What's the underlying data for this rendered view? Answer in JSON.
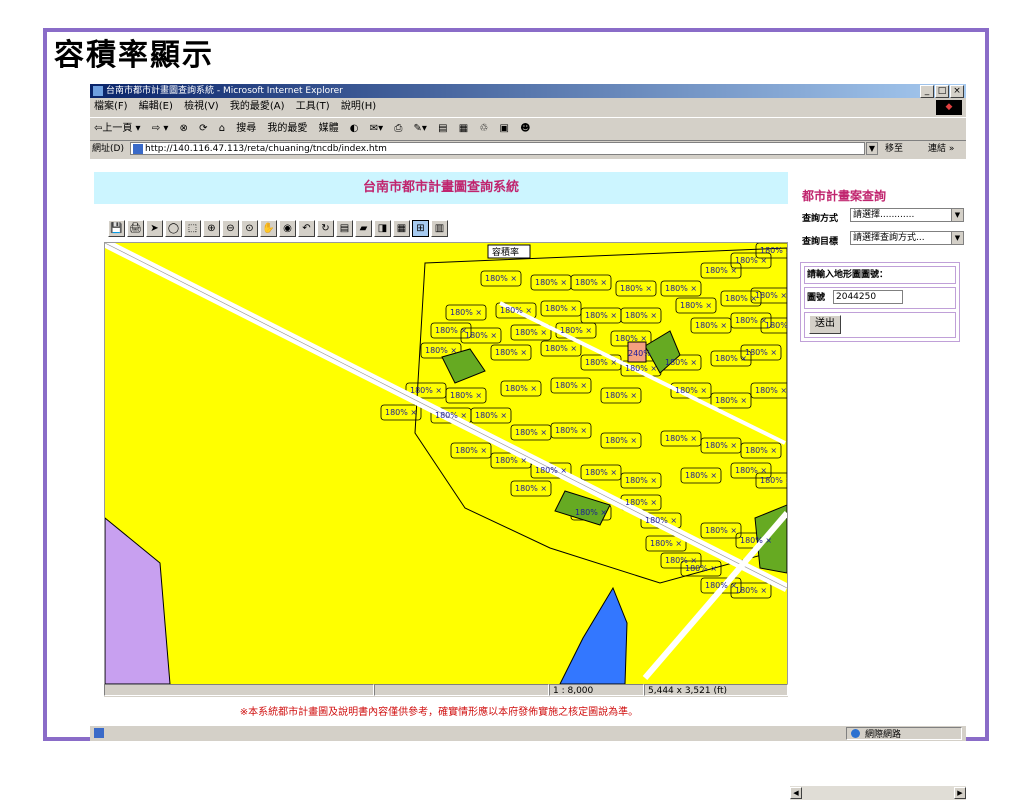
{
  "slide": {
    "title": "容積率顯示"
  },
  "browser": {
    "title": "台南市都市計畫圖查詢系統 - Microsoft Internet Explorer",
    "window_buttons": [
      "_",
      "□",
      "×"
    ],
    "menu": [
      "檔案(F)",
      "編輯(E)",
      "檢視(V)",
      "我的最愛(A)",
      "工具(T)",
      "說明(H)"
    ],
    "toolbar": [
      "⇦上一頁 ▾",
      "⇨ ▾",
      "⊗",
      "⟳",
      "⌂",
      "搜尋",
      "我的最愛",
      "媒體",
      "◐",
      "✉▾",
      "⎙",
      "✎▾",
      "▤",
      "▦",
      "♲",
      "▣",
      "☻"
    ],
    "address_label": "網址(D)",
    "address": "http://140.116.47.113/reta/chuaning/tncdb/index.htm",
    "go_label": "移至",
    "links_label": "連結 »",
    "zone": "網際網路"
  },
  "page": {
    "header": "台南市都市計畫圖查詢系統",
    "map_tools": [
      "💾",
      "🖨",
      "➤",
      "◯",
      "⬚",
      "⊕",
      "⊖",
      "⊙",
      "✋",
      "◉",
      "↶",
      "↻",
      "▤",
      "▰",
      "◨",
      "▦",
      "⊞",
      "▥"
    ],
    "map_title": "容積率",
    "scale": "1 : 8,000",
    "extent": "5,444 x 3,521 (ft)",
    "disclaimer": "※本系統都市計畫圖及說明書內容僅供參考，確實情形應以本府發佈實施之核定圖說為準。",
    "far_label": "180%",
    "far_special": "240%"
  },
  "query": {
    "title": "都市計畫案查詢",
    "method_label": "查詢方式",
    "method_value": "請選擇............",
    "target_label": "查詢目標",
    "target_value": "請選擇查詢方式...",
    "prompt": "請輸入地形圖圖號：",
    "sheet_label": "圖號",
    "sheet_value": "2044250",
    "submit": "送出"
  },
  "colors": {
    "map_yellow": "#ffff00",
    "park_green": "#66aa22",
    "purple_zone": "#c8a0f0",
    "water_blue": "#3377ff",
    "far_240": "#f4a080",
    "header_bg": "#ccf5ff",
    "title_magenta": "#c0246e"
  }
}
